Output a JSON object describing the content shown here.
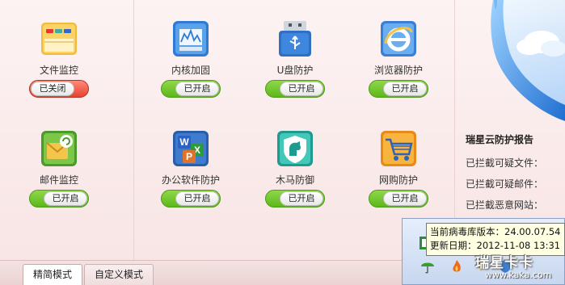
{
  "modules": [
    {
      "label": "文件监控",
      "status": "已关闭",
      "icon": "folder-icon",
      "on": false
    },
    {
      "label": "内核加固",
      "status": "已开启",
      "icon": "kernel-shield-icon",
      "on": true
    },
    {
      "label": "U盘防护",
      "status": "已开启",
      "icon": "usb-drive-icon",
      "on": true
    },
    {
      "label": "浏览器防护",
      "status": "已开启",
      "icon": "browser-icon",
      "on": true
    },
    {
      "label": "邮件监控",
      "status": "已开启",
      "icon": "mail-icon",
      "on": true
    },
    {
      "label": "办公软件防护",
      "status": "已开启",
      "icon": "office-icon",
      "on": true
    },
    {
      "label": "木马防御",
      "status": "已开启",
      "icon": "horse-shield-icon",
      "on": true
    },
    {
      "label": "网购防护",
      "status": "已开启",
      "icon": "shopping-cart-icon",
      "on": true
    }
  ],
  "report": {
    "title": "瑞星云防护报告",
    "rows": [
      "已拦截可疑文件：",
      "已拦截可疑邮件：",
      "已拦截恶意网站："
    ]
  },
  "tabs": {
    "simple": "精简模式",
    "custom": "自定义模式"
  },
  "tooltip": {
    "line1": "当前病毒库版本：24.00.07.54",
    "line2": "更新日期：2012-11-08 13:31"
  },
  "watermark": {
    "big": "瑞星卡卡",
    "small": "www.kaka.com"
  },
  "colors": {
    "on": "#5cb71a",
    "off": "#e7422f",
    "background": "#fbeeee"
  }
}
